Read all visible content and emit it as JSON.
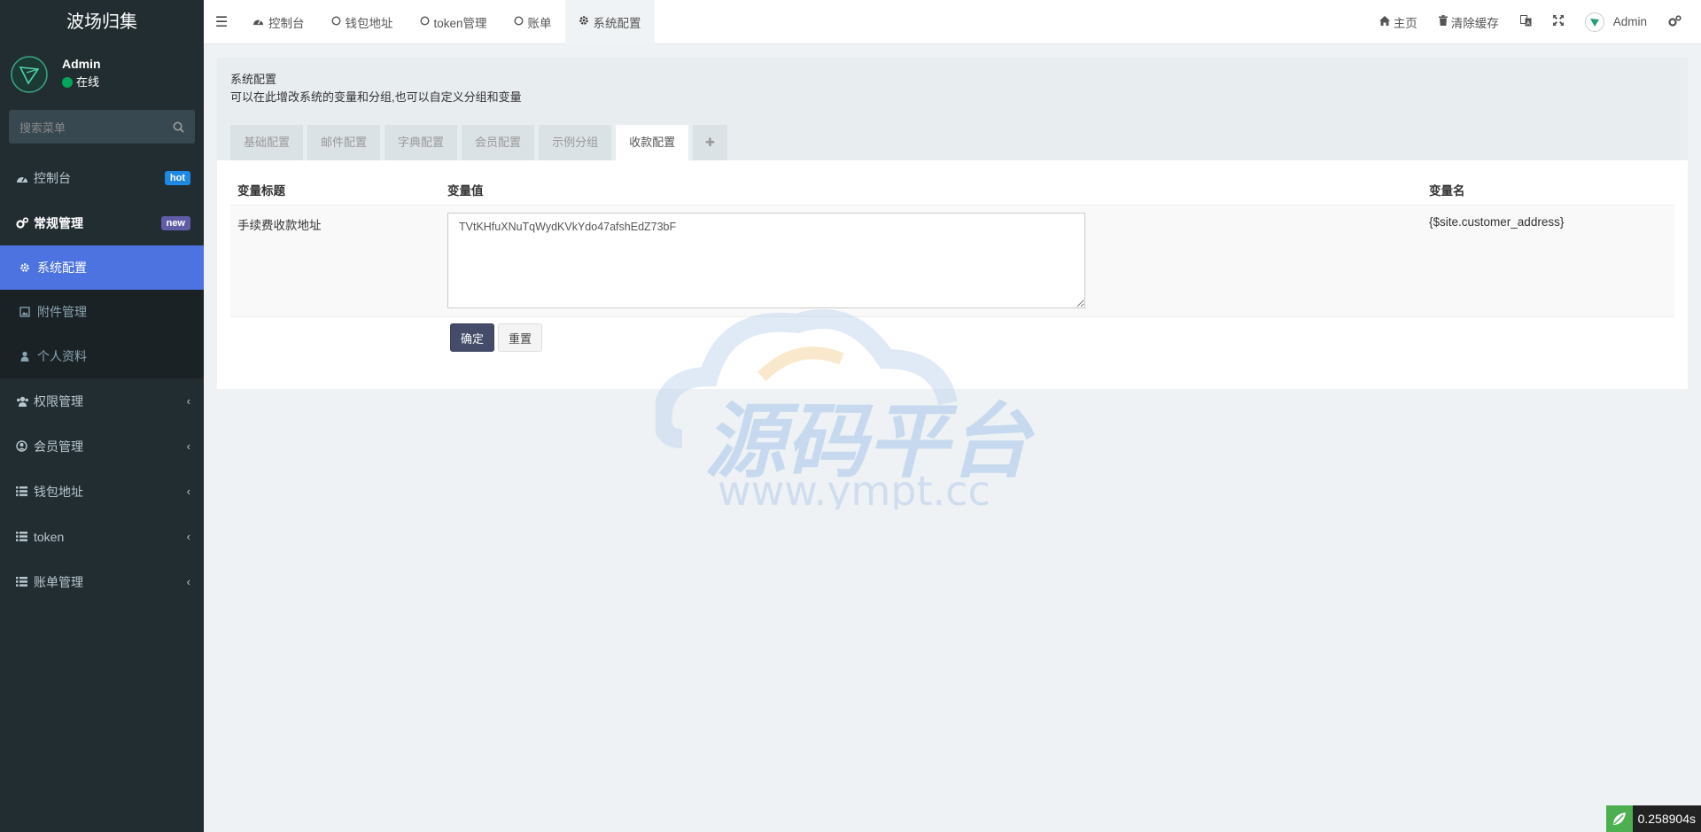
{
  "app": {
    "title": "波场归集"
  },
  "user": {
    "name": "Admin",
    "status": "在线"
  },
  "sidebar": {
    "search_placeholder": "搜索菜单",
    "items": [
      {
        "label": "控制台",
        "badge": "hot"
      },
      {
        "label": "常规管理",
        "badge": "new"
      },
      {
        "label": "系统配置"
      },
      {
        "label": "附件管理"
      },
      {
        "label": "个人资料"
      },
      {
        "label": "权限管理"
      },
      {
        "label": "会员管理"
      },
      {
        "label": "钱包地址"
      },
      {
        "label": "token"
      },
      {
        "label": "账单管理"
      }
    ]
  },
  "topbar": {
    "tabs": [
      {
        "label": "控制台"
      },
      {
        "label": "钱包地址"
      },
      {
        "label": "token管理"
      },
      {
        "label": "账单"
      },
      {
        "label": "系统配置"
      }
    ],
    "home": "主页",
    "clear_cache": "清除缓存",
    "user": "Admin"
  },
  "panel": {
    "title": "系统配置",
    "description": "可以在此增改系统的变量和分组,也可以自定义分组和变量",
    "tabs": [
      "基础配置",
      "邮件配置",
      "字典配置",
      "会员配置",
      "示例分组",
      "收款配置"
    ],
    "active_tab": "收款配置"
  },
  "table": {
    "headers": [
      "变量标题",
      "变量值",
      "变量名"
    ],
    "rows": [
      {
        "title": "手续费收款地址",
        "value": "TVtKHfuXNuTqWydKVkYdo47afshEdZ73bF",
        "name": "{$site.customer_address}"
      }
    ]
  },
  "buttons": {
    "confirm": "确定",
    "reset": "重置"
  },
  "watermark": {
    "text": "源码平台",
    "url": "www.ympt.cc"
  },
  "timer": "0.258904s",
  "colors": {
    "sidebar_bg": "#222d32",
    "active_item": "#4c73e0",
    "primary_btn": "#444c69"
  }
}
